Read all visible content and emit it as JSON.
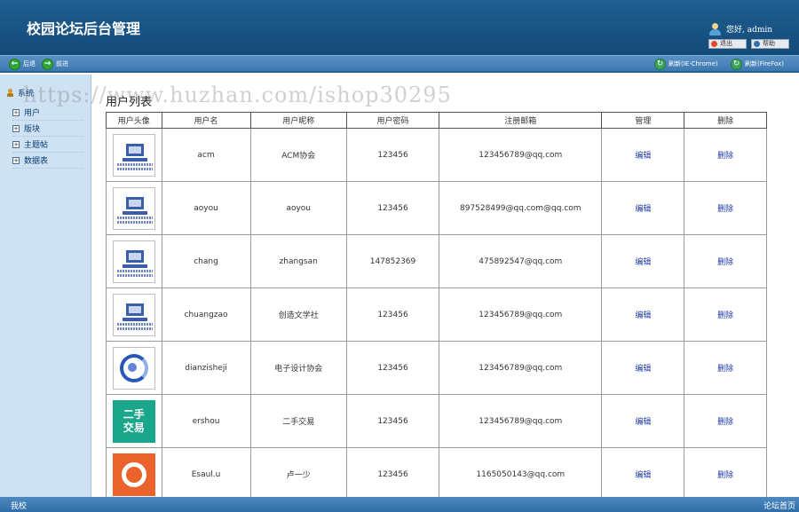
{
  "header": {
    "title": "校园论坛后台管理",
    "greeting": "您好, admin",
    "logout_label": "退出",
    "help_label": "帮助"
  },
  "toolbar": {
    "back_label": "后退",
    "forward_label": "前进",
    "refresh_ie_label": "刷新(IE·Chrome)",
    "refresh_ff_label": "刷新(FireFox)"
  },
  "sidebar": {
    "root_label": "系统",
    "items": [
      {
        "label": "用户"
      },
      {
        "label": "版块"
      },
      {
        "label": "主题帖"
      },
      {
        "label": "数据表"
      }
    ]
  },
  "main": {
    "title": "用户列表",
    "columns": [
      "用户头像",
      "用户名",
      "用户昵称",
      "用户密码",
      "注册邮箱",
      "管理",
      "删除"
    ],
    "rows": [
      {
        "username": "acm",
        "nickname": "ACM协会",
        "password": "123456",
        "email": "123456789@qq.com",
        "edit": "编辑",
        "delete": "删除",
        "avatar": "computer-association-avatar"
      },
      {
        "username": "aoyou",
        "nickname": "aoyou",
        "password": "123456",
        "email": "897528499@qq.com@qq.com",
        "edit": "编辑",
        "delete": "删除",
        "avatar": "computer-association-avatar"
      },
      {
        "username": "chang",
        "nickname": "zhangsan",
        "password": "147852369",
        "email": "475892547@qq.com",
        "edit": "编辑",
        "delete": "删除",
        "avatar": "computer-association-avatar"
      },
      {
        "username": "chuangzao",
        "nickname": "创造文学社",
        "password": "123456",
        "email": "123456789@qq.com",
        "edit": "编辑",
        "delete": "删除",
        "avatar": "computer-association-avatar"
      },
      {
        "username": "dianzisheji",
        "nickname": "电子设计协会",
        "password": "123456",
        "email": "123456789@qq.com",
        "edit": "编辑",
        "delete": "删除",
        "avatar": "electronics-logo-avatar"
      },
      {
        "username": "ershou",
        "nickname": "二手交易",
        "password": "123456",
        "email": "123456789@qq.com",
        "edit": "编辑",
        "delete": "删除",
        "avatar": "secondhand-trade-avatar"
      },
      {
        "username": "Esaul.u",
        "nickname": "卢一少",
        "password": "123456",
        "email": "1165050143@qq.com",
        "edit": "编辑",
        "delete": "删除",
        "avatar": "ubuntu-logo-avatar"
      }
    ],
    "ershou_avatar_line1": "二手",
    "ershou_avatar_line2": "交易"
  },
  "watermark": "https://www.huzhan.com/ishop30295",
  "footer": {
    "left": "我校",
    "right": "论坛首页"
  }
}
